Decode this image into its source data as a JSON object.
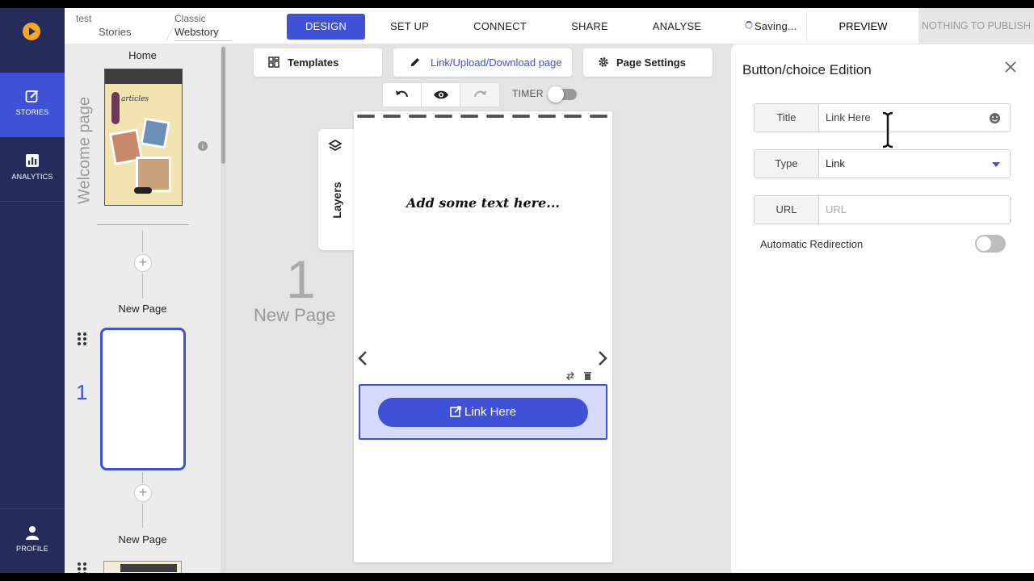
{
  "rail": {
    "stories": "STORIES",
    "analytics": "ANALYTICS",
    "profile": "PROFILE"
  },
  "breadcrumb": {
    "project": "test",
    "section": "Stories",
    "template": "Classic",
    "type": "Webstory"
  },
  "nav": {
    "design": "DESIGN",
    "setup": "SET UP",
    "connect": "CONNECT",
    "share": "SHARE",
    "analyse": "ANALYSE",
    "saving": "Saving...",
    "preview": "PREVIEW",
    "publish": "NOTHING TO PUBLISH"
  },
  "pages": {
    "home_title": "Home",
    "welcome_label": "Welcome page",
    "thumb_caption": "articles",
    "page1_title": "New Page",
    "page1_number": "1",
    "page2_title": "New Page"
  },
  "toolbar": {
    "templates": "Templates",
    "link_upload": "Link/Upload/Download page",
    "page_settings": "Page Settings",
    "timer": "TIMER"
  },
  "canvas": {
    "layers": "Layers",
    "page_number": "1",
    "page_label": "New Page",
    "placeholder_text": "Add some text here...",
    "button_label": "Link Here"
  },
  "panel": {
    "title": "Button/choice Edition",
    "title_label": "Title",
    "title_value": "Link Here",
    "type_label": "Type",
    "type_value": "Link",
    "url_label": "URL",
    "url_placeholder": "URL",
    "auto_redirect_label": "Automatic Redirection",
    "auto_redirect_on": false
  },
  "colors": {
    "accent": "#3f51d7",
    "rail_bg": "#262c59",
    "logo": "#f5a623"
  }
}
